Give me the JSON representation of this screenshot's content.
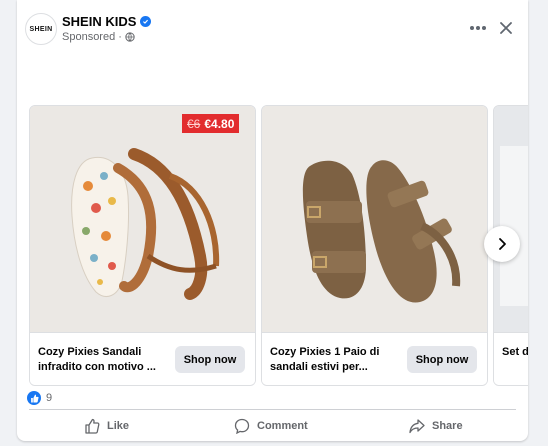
{
  "post": {
    "page_name": "SHEIN KIDS",
    "avatar_text": "SHEIN",
    "sponsored_label": "Sponsored ·",
    "verified_icon": "verified-badge-icon",
    "privacy_icon": "globe-icon"
  },
  "carousel": {
    "items": [
      {
        "title": "Cozy Pixies Sandali infradito con motivo ...",
        "button": "Shop now",
        "old_price": "€6",
        "price": "€4.80"
      },
      {
        "title": "Cozy Pixies 1 Paio di sandali estivi per...",
        "button": "Shop now"
      },
      {
        "title": "Set d Magl"
      }
    ]
  },
  "reactions": {
    "count": "9"
  },
  "actions": {
    "like": "Like",
    "comment": "Comment",
    "share": "Share"
  },
  "colors": {
    "brand_blue": "#1877f2",
    "price_badge": "#e22c2e",
    "button_bg": "#e4e6eb"
  }
}
